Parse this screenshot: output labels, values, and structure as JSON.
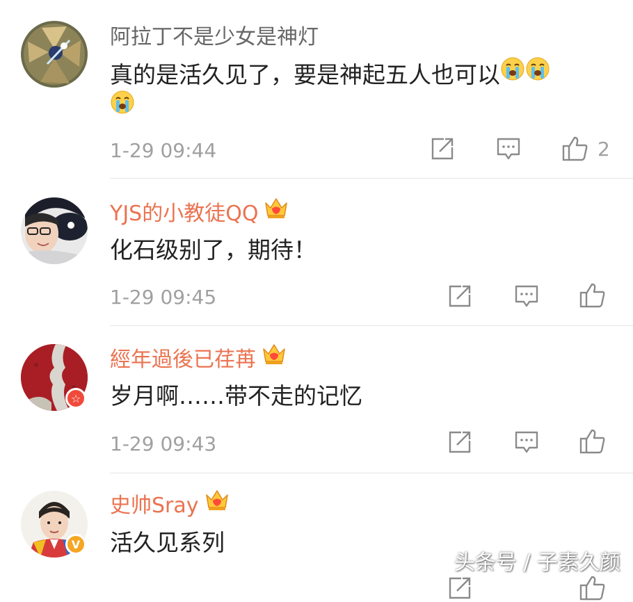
{
  "comments": [
    {
      "username": "阿拉丁不是少女是神灯",
      "vip": false,
      "text_line1": "真的是活久见了，要是神起五人也可以",
      "timestamp": "1-29 09:44",
      "like_count": "2"
    },
    {
      "username": "YJS的小教徒QQ",
      "vip": true,
      "text_line1": "化石级别了，期待！",
      "timestamp": "1-29 09:45",
      "like_count": ""
    },
    {
      "username": "經年過後已荏苒",
      "vip": true,
      "text_line1": "岁月啊……带不走的记忆",
      "timestamp": "1-29 09:43",
      "like_count": ""
    },
    {
      "username": "史帅Sray",
      "vip": true,
      "text_line1": "活久见系列",
      "timestamp": "",
      "like_count": ""
    }
  ],
  "watermark": "头条号 / 子素久颜",
  "icons": {
    "share": "share-icon",
    "comment": "comment-icon",
    "like": "thumbs-up-icon",
    "crown": "crown-vip-icon",
    "crying": "crying-emoji-icon"
  },
  "colors": {
    "vip_name": "#eb7350",
    "plain_name": "#666666",
    "text": "#222222",
    "meta": "#a0a0a0",
    "divider": "#e6e6e6"
  }
}
